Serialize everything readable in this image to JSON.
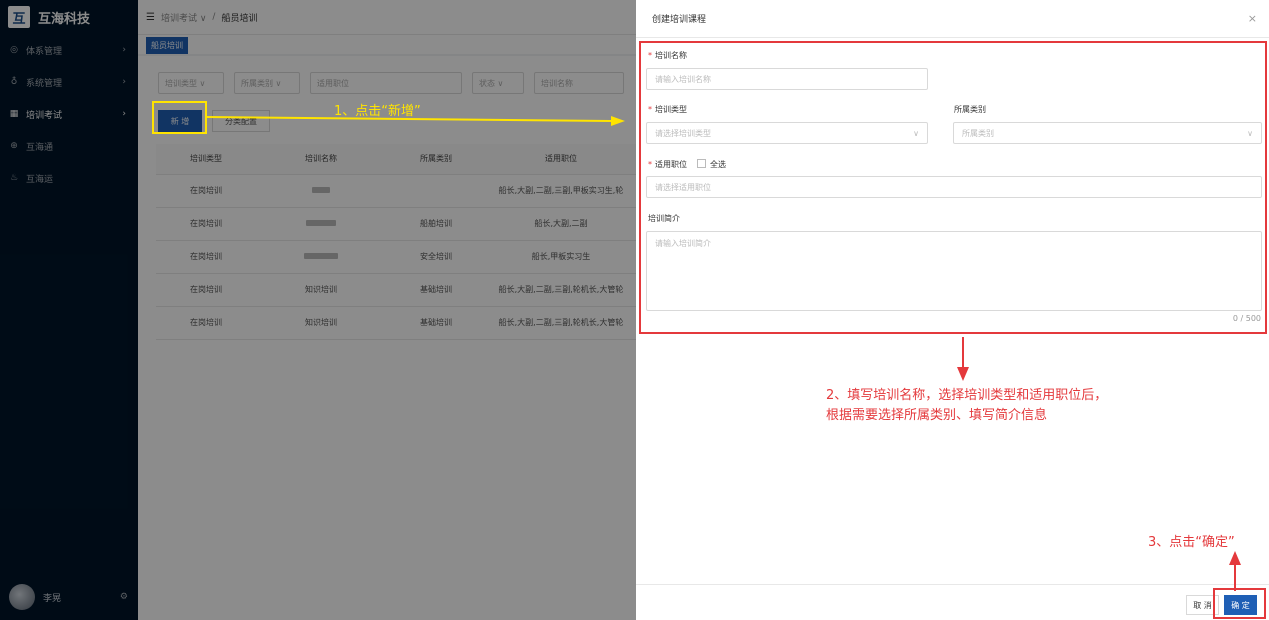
{
  "brand": {
    "logo_glyph": "互",
    "name": "互海科技"
  },
  "sidebar": {
    "items": [
      {
        "icon": "◎",
        "icon_name": "system-circle-icon",
        "label": "体系管理",
        "chevron": "›"
      },
      {
        "icon": "♁",
        "icon_name": "user-settings-icon",
        "label": "系统管理",
        "chevron": "›"
      },
      {
        "icon": "▦",
        "icon_name": "grid-icon",
        "label": "培训考试",
        "chevron": "›"
      },
      {
        "icon": "⊕",
        "icon_name": "globe-icon",
        "label": "互海通",
        "chevron": ""
      },
      {
        "icon": "♨",
        "icon_name": "app-icon",
        "label": "互海运",
        "chevron": ""
      }
    ],
    "user_name": "李晃",
    "settings_icon": "⚙"
  },
  "header": {
    "menu_icon": "☰",
    "breadcrumb_parent": "培训考试 ∨",
    "separator": "/",
    "breadcrumb_current": "船员培训"
  },
  "tabs": {
    "active": "船员培训"
  },
  "filters": [
    {
      "label": "培训类型 ∨"
    },
    {
      "label": "所属类别 ∨"
    },
    {
      "label": "适用职位"
    },
    {
      "label": "状态 ∨"
    },
    {
      "label": "培训名称"
    }
  ],
  "toolbar": {
    "new_label": "新 增",
    "category_label": "分类配置"
  },
  "table": {
    "headers": [
      "培训类型",
      "培训名称",
      "所属类别",
      "适用职位"
    ],
    "rows": [
      [
        "在岗培训",
        "",
        "",
        "船长,大副,二副,三副,甲板实习生,轮"
      ],
      [
        "在岗培训",
        "",
        "船舶培训",
        "船长,大副,二副"
      ],
      [
        "在岗培训",
        "",
        "安全培训",
        "船长,甲板实习生"
      ],
      [
        "在岗培训",
        "知识培训",
        "基础培训",
        "船长,大副,二副,三副,轮机长,大管轮"
      ],
      [
        "在岗培训",
        "知识培训",
        "基础培训",
        "船长,大副,二副,三副,轮机长,大管轮"
      ]
    ]
  },
  "drawer": {
    "title": "创建培训课程",
    "close": "×",
    "required_mark": "*",
    "name_label": "培训名称",
    "name_placeholder": "请输入培训名称",
    "type_label": "培训类型",
    "type_placeholder": "请选择培训类型",
    "category_label": "所属类别",
    "category_placeholder": "所属类别",
    "position_label": "适用职位",
    "select_all": "全选",
    "position_placeholder": "请选择适用职位",
    "intro_label": "培训简介",
    "intro_placeholder": "请输入培训简介",
    "counter": "0 / 500",
    "arrow": "∨",
    "cancel": "取 消",
    "ok": "确 定"
  },
  "annotations": {
    "step1": "1、点击“新增”",
    "step2_line1": "2、填写培训名称，选择培训类型和适用职位后，",
    "step2_line2": "根据需要选择所属类别、填写简介信息",
    "step3": "3、点击“确定”"
  },
  "colors": {
    "primary": "#1f5fb5",
    "sidebar": "#001529",
    "annotation_red": "#e4393c",
    "annotation_yellow": "#ffe400"
  }
}
